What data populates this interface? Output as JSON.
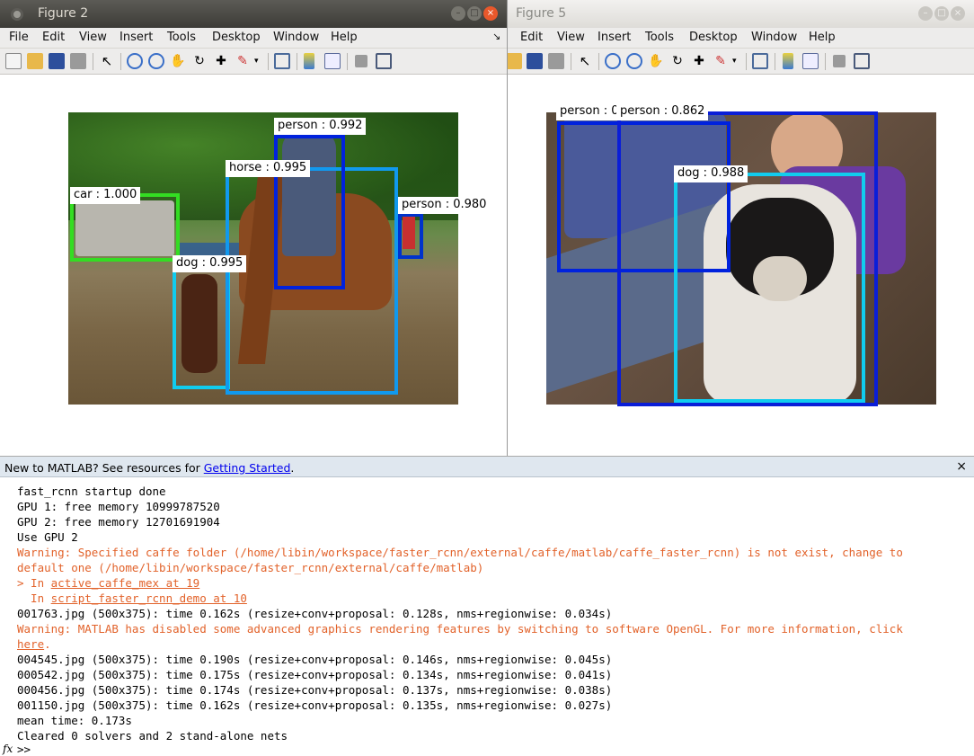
{
  "figures": [
    {
      "id": "fig2",
      "title": "Figure 2",
      "menu": [
        "File",
        "Edit",
        "View",
        "Insert",
        "Tools",
        "Desktop",
        "Window",
        "Help"
      ],
      "detections": [
        {
          "label": "car : 1.000",
          "color": "#33dd22"
        },
        {
          "label": "dog : 0.995",
          "color": "#11ccee"
        },
        {
          "label": "horse : 0.995",
          "color": "#1199ee"
        },
        {
          "label": "person : 0.992",
          "color": "#0022dd"
        },
        {
          "label": "person : 0.980",
          "color": "#0033cc"
        }
      ]
    },
    {
      "id": "fig5",
      "title": "Figure 5",
      "menu": [
        "Edit",
        "View",
        "Insert",
        "Tools",
        "Desktop",
        "Window",
        "Help"
      ],
      "detections": [
        {
          "label": "person : 0",
          "color": "#0022dd"
        },
        {
          "label": "person : 0.862",
          "color": "#0a1ed8"
        },
        {
          "label": "dog : 0.988",
          "color": "#11ccee"
        }
      ]
    }
  ],
  "window_buttons": {
    "minimize": "–",
    "maximize": "□",
    "close": "×"
  },
  "console": {
    "banner_text": "New to MATLAB? See resources for ",
    "banner_link": "Getting Started",
    "banner_end": ".",
    "close": "×",
    "lines": [
      {
        "t": "fast_rcnn startup done",
        "k": "n"
      },
      {
        "t": "GPU 1: free memory 10999787520",
        "k": "n"
      },
      {
        "t": "GPU 2: free memory 12701691904",
        "k": "n"
      },
      {
        "t": "Use GPU 2",
        "k": "n"
      },
      {
        "t": "Warning: Specified caffe folder (/home/libin/workspace/faster_rcnn/external/caffe/matlab/caffe_faster_rcnn) is not exist, change to",
        "k": "w"
      },
      {
        "t": "default one (/home/libin/workspace/faster_rcnn/external/caffe/matlab)",
        "k": "w"
      },
      {
        "t": "> In ",
        "link": "active_caffe_mex at 19",
        "k": "wl"
      },
      {
        "t": "  In ",
        "link": "script_faster_rcnn_demo at 10",
        "k": "wl"
      },
      {
        "t": "001763.jpg (500x375): time 0.162s (resize+conv+proposal: 0.128s, nms+regionwise: 0.034s)",
        "k": "n"
      },
      {
        "t": "Warning: MATLAB has disabled some advanced graphics rendering features by switching to software OpenGL. For more information, click",
        "k": "w"
      },
      {
        "t": "",
        "link": "here",
        "tail": ".",
        "k": "wl"
      },
      {
        "t": "004545.jpg (500x375): time 0.190s (resize+conv+proposal: 0.146s, nms+regionwise: 0.045s)",
        "k": "n"
      },
      {
        "t": "000542.jpg (500x375): time 0.175s (resize+conv+proposal: 0.134s, nms+regionwise: 0.041s)",
        "k": "n"
      },
      {
        "t": "000456.jpg (500x375): time 0.174s (resize+conv+proposal: 0.137s, nms+regionwise: 0.038s)",
        "k": "n"
      },
      {
        "t": "001150.jpg (500x375): time 0.162s (resize+conv+proposal: 0.135s, nms+regionwise: 0.027s)",
        "k": "n"
      },
      {
        "t": "mean time: 0.173s",
        "k": "n"
      },
      {
        "t": "Cleared 0 solvers and 2 stand-alone nets",
        "k": "n"
      }
    ],
    "fx": "fx",
    "prompt": ">>"
  }
}
